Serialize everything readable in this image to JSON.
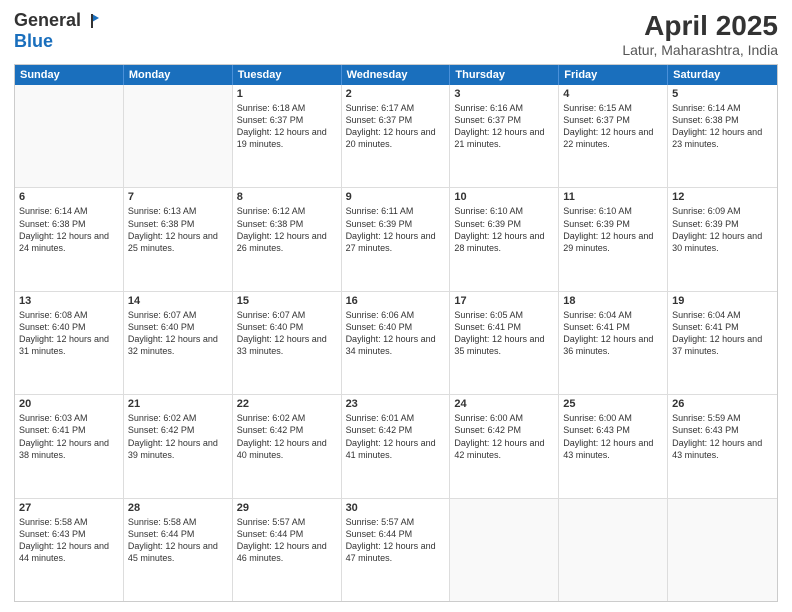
{
  "logo": {
    "general": "General",
    "blue": "Blue"
  },
  "header": {
    "title": "April 2025",
    "subtitle": "Latur, Maharashtra, India"
  },
  "weekdays": [
    "Sunday",
    "Monday",
    "Tuesday",
    "Wednesday",
    "Thursday",
    "Friday",
    "Saturday"
  ],
  "weeks": [
    [
      {
        "day": "",
        "sunrise": "",
        "sunset": "",
        "daylight": "",
        "empty": true
      },
      {
        "day": "",
        "sunrise": "",
        "sunset": "",
        "daylight": "",
        "empty": true
      },
      {
        "day": "1",
        "sunrise": "Sunrise: 6:18 AM",
        "sunset": "Sunset: 6:37 PM",
        "daylight": "Daylight: 12 hours and 19 minutes."
      },
      {
        "day": "2",
        "sunrise": "Sunrise: 6:17 AM",
        "sunset": "Sunset: 6:37 PM",
        "daylight": "Daylight: 12 hours and 20 minutes."
      },
      {
        "day": "3",
        "sunrise": "Sunrise: 6:16 AM",
        "sunset": "Sunset: 6:37 PM",
        "daylight": "Daylight: 12 hours and 21 minutes."
      },
      {
        "day": "4",
        "sunrise": "Sunrise: 6:15 AM",
        "sunset": "Sunset: 6:37 PM",
        "daylight": "Daylight: 12 hours and 22 minutes."
      },
      {
        "day": "5",
        "sunrise": "Sunrise: 6:14 AM",
        "sunset": "Sunset: 6:38 PM",
        "daylight": "Daylight: 12 hours and 23 minutes."
      }
    ],
    [
      {
        "day": "6",
        "sunrise": "Sunrise: 6:14 AM",
        "sunset": "Sunset: 6:38 PM",
        "daylight": "Daylight: 12 hours and 24 minutes."
      },
      {
        "day": "7",
        "sunrise": "Sunrise: 6:13 AM",
        "sunset": "Sunset: 6:38 PM",
        "daylight": "Daylight: 12 hours and 25 minutes."
      },
      {
        "day": "8",
        "sunrise": "Sunrise: 6:12 AM",
        "sunset": "Sunset: 6:38 PM",
        "daylight": "Daylight: 12 hours and 26 minutes."
      },
      {
        "day": "9",
        "sunrise": "Sunrise: 6:11 AM",
        "sunset": "Sunset: 6:39 PM",
        "daylight": "Daylight: 12 hours and 27 minutes."
      },
      {
        "day": "10",
        "sunrise": "Sunrise: 6:10 AM",
        "sunset": "Sunset: 6:39 PM",
        "daylight": "Daylight: 12 hours and 28 minutes."
      },
      {
        "day": "11",
        "sunrise": "Sunrise: 6:10 AM",
        "sunset": "Sunset: 6:39 PM",
        "daylight": "Daylight: 12 hours and 29 minutes."
      },
      {
        "day": "12",
        "sunrise": "Sunrise: 6:09 AM",
        "sunset": "Sunset: 6:39 PM",
        "daylight": "Daylight: 12 hours and 30 minutes."
      }
    ],
    [
      {
        "day": "13",
        "sunrise": "Sunrise: 6:08 AM",
        "sunset": "Sunset: 6:40 PM",
        "daylight": "Daylight: 12 hours and 31 minutes."
      },
      {
        "day": "14",
        "sunrise": "Sunrise: 6:07 AM",
        "sunset": "Sunset: 6:40 PM",
        "daylight": "Daylight: 12 hours and 32 minutes."
      },
      {
        "day": "15",
        "sunrise": "Sunrise: 6:07 AM",
        "sunset": "Sunset: 6:40 PM",
        "daylight": "Daylight: 12 hours and 33 minutes."
      },
      {
        "day": "16",
        "sunrise": "Sunrise: 6:06 AM",
        "sunset": "Sunset: 6:40 PM",
        "daylight": "Daylight: 12 hours and 34 minutes."
      },
      {
        "day": "17",
        "sunrise": "Sunrise: 6:05 AM",
        "sunset": "Sunset: 6:41 PM",
        "daylight": "Daylight: 12 hours and 35 minutes."
      },
      {
        "day": "18",
        "sunrise": "Sunrise: 6:04 AM",
        "sunset": "Sunset: 6:41 PM",
        "daylight": "Daylight: 12 hours and 36 minutes."
      },
      {
        "day": "19",
        "sunrise": "Sunrise: 6:04 AM",
        "sunset": "Sunset: 6:41 PM",
        "daylight": "Daylight: 12 hours and 37 minutes."
      }
    ],
    [
      {
        "day": "20",
        "sunrise": "Sunrise: 6:03 AM",
        "sunset": "Sunset: 6:41 PM",
        "daylight": "Daylight: 12 hours and 38 minutes."
      },
      {
        "day": "21",
        "sunrise": "Sunrise: 6:02 AM",
        "sunset": "Sunset: 6:42 PM",
        "daylight": "Daylight: 12 hours and 39 minutes."
      },
      {
        "day": "22",
        "sunrise": "Sunrise: 6:02 AM",
        "sunset": "Sunset: 6:42 PM",
        "daylight": "Daylight: 12 hours and 40 minutes."
      },
      {
        "day": "23",
        "sunrise": "Sunrise: 6:01 AM",
        "sunset": "Sunset: 6:42 PM",
        "daylight": "Daylight: 12 hours and 41 minutes."
      },
      {
        "day": "24",
        "sunrise": "Sunrise: 6:00 AM",
        "sunset": "Sunset: 6:42 PM",
        "daylight": "Daylight: 12 hours and 42 minutes."
      },
      {
        "day": "25",
        "sunrise": "Sunrise: 6:00 AM",
        "sunset": "Sunset: 6:43 PM",
        "daylight": "Daylight: 12 hours and 43 minutes."
      },
      {
        "day": "26",
        "sunrise": "Sunrise: 5:59 AM",
        "sunset": "Sunset: 6:43 PM",
        "daylight": "Daylight: 12 hours and 43 minutes."
      }
    ],
    [
      {
        "day": "27",
        "sunrise": "Sunrise: 5:58 AM",
        "sunset": "Sunset: 6:43 PM",
        "daylight": "Daylight: 12 hours and 44 minutes."
      },
      {
        "day": "28",
        "sunrise": "Sunrise: 5:58 AM",
        "sunset": "Sunset: 6:44 PM",
        "daylight": "Daylight: 12 hours and 45 minutes."
      },
      {
        "day": "29",
        "sunrise": "Sunrise: 5:57 AM",
        "sunset": "Sunset: 6:44 PM",
        "daylight": "Daylight: 12 hours and 46 minutes."
      },
      {
        "day": "30",
        "sunrise": "Sunrise: 5:57 AM",
        "sunset": "Sunset: 6:44 PM",
        "daylight": "Daylight: 12 hours and 47 minutes."
      },
      {
        "day": "",
        "sunrise": "",
        "sunset": "",
        "daylight": "",
        "empty": true
      },
      {
        "day": "",
        "sunrise": "",
        "sunset": "",
        "daylight": "",
        "empty": true
      },
      {
        "day": "",
        "sunrise": "",
        "sunset": "",
        "daylight": "",
        "empty": true
      }
    ]
  ]
}
